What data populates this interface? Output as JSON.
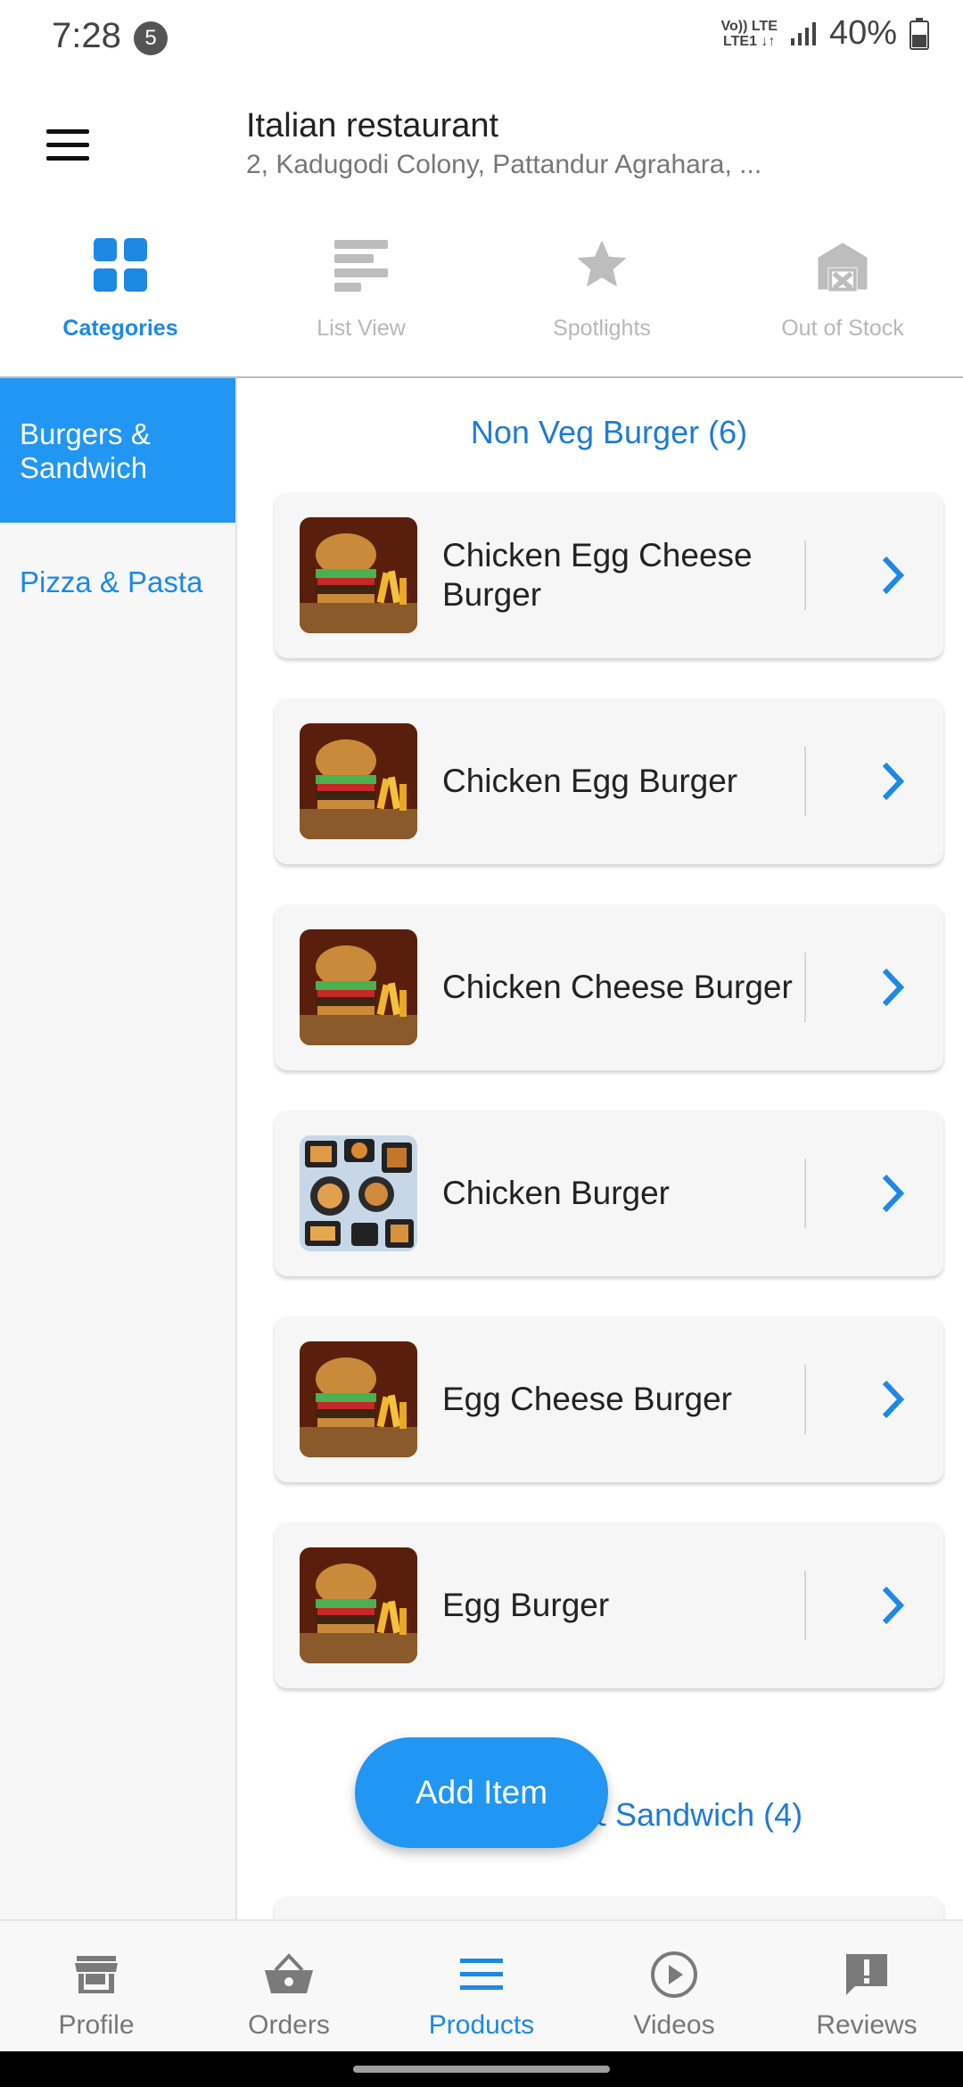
{
  "status_bar": {
    "time": "7:28",
    "notification_count": "5",
    "network_top": "Vo)) LTE",
    "network_bottom": "LTE1 ↓↑",
    "battery": "40%"
  },
  "header": {
    "store_name": "Italian restaurant",
    "store_address": "2, Kadugodi Colony, Pattandur Agrahara, ..."
  },
  "top_tabs": [
    {
      "label": "Categories",
      "icon": "grid-icon",
      "active": true
    },
    {
      "label": "List View",
      "icon": "list-icon",
      "active": false
    },
    {
      "label": "Spotlights",
      "icon": "star-icon",
      "active": false
    },
    {
      "label": "Out of Stock",
      "icon": "warehouse-x-icon",
      "active": false
    }
  ],
  "sidebar": {
    "items": [
      {
        "label": "Burgers & Sandwich",
        "active": true
      },
      {
        "label": "Pizza & Pasta",
        "active": false
      }
    ]
  },
  "sections": [
    {
      "title": "Non Veg Burger (6)",
      "items": [
        {
          "name": "Chicken Egg Cheese Burger",
          "image": "burger-image"
        },
        {
          "name": "Chicken Egg Burger",
          "image": "burger-image"
        },
        {
          "name": "Chicken Cheese Burger",
          "image": "burger-image"
        },
        {
          "name": "Chicken Burger",
          "image": "snacks-image"
        },
        {
          "name": "Egg Cheese Burger",
          "image": "burger-image"
        },
        {
          "name": "Egg Burger",
          "image": "burger-image"
        }
      ]
    },
    {
      "title": "Veg Burger & Sandwich (4)"
    }
  ],
  "fab": {
    "label": "Add Item"
  },
  "bottom_nav": [
    {
      "label": "Profile",
      "icon": "store-icon",
      "active": false
    },
    {
      "label": "Orders",
      "icon": "basket-icon",
      "active": false
    },
    {
      "label": "Products",
      "icon": "menu-lines-icon",
      "active": true
    },
    {
      "label": "Videos",
      "icon": "play-circle-icon",
      "active": false
    },
    {
      "label": "Reviews",
      "icon": "review-alert-icon",
      "active": false
    }
  ],
  "colors": {
    "accent": "#1e88e5",
    "sidebar_active": "#2196f3",
    "inactive": "#b8b8b8"
  }
}
